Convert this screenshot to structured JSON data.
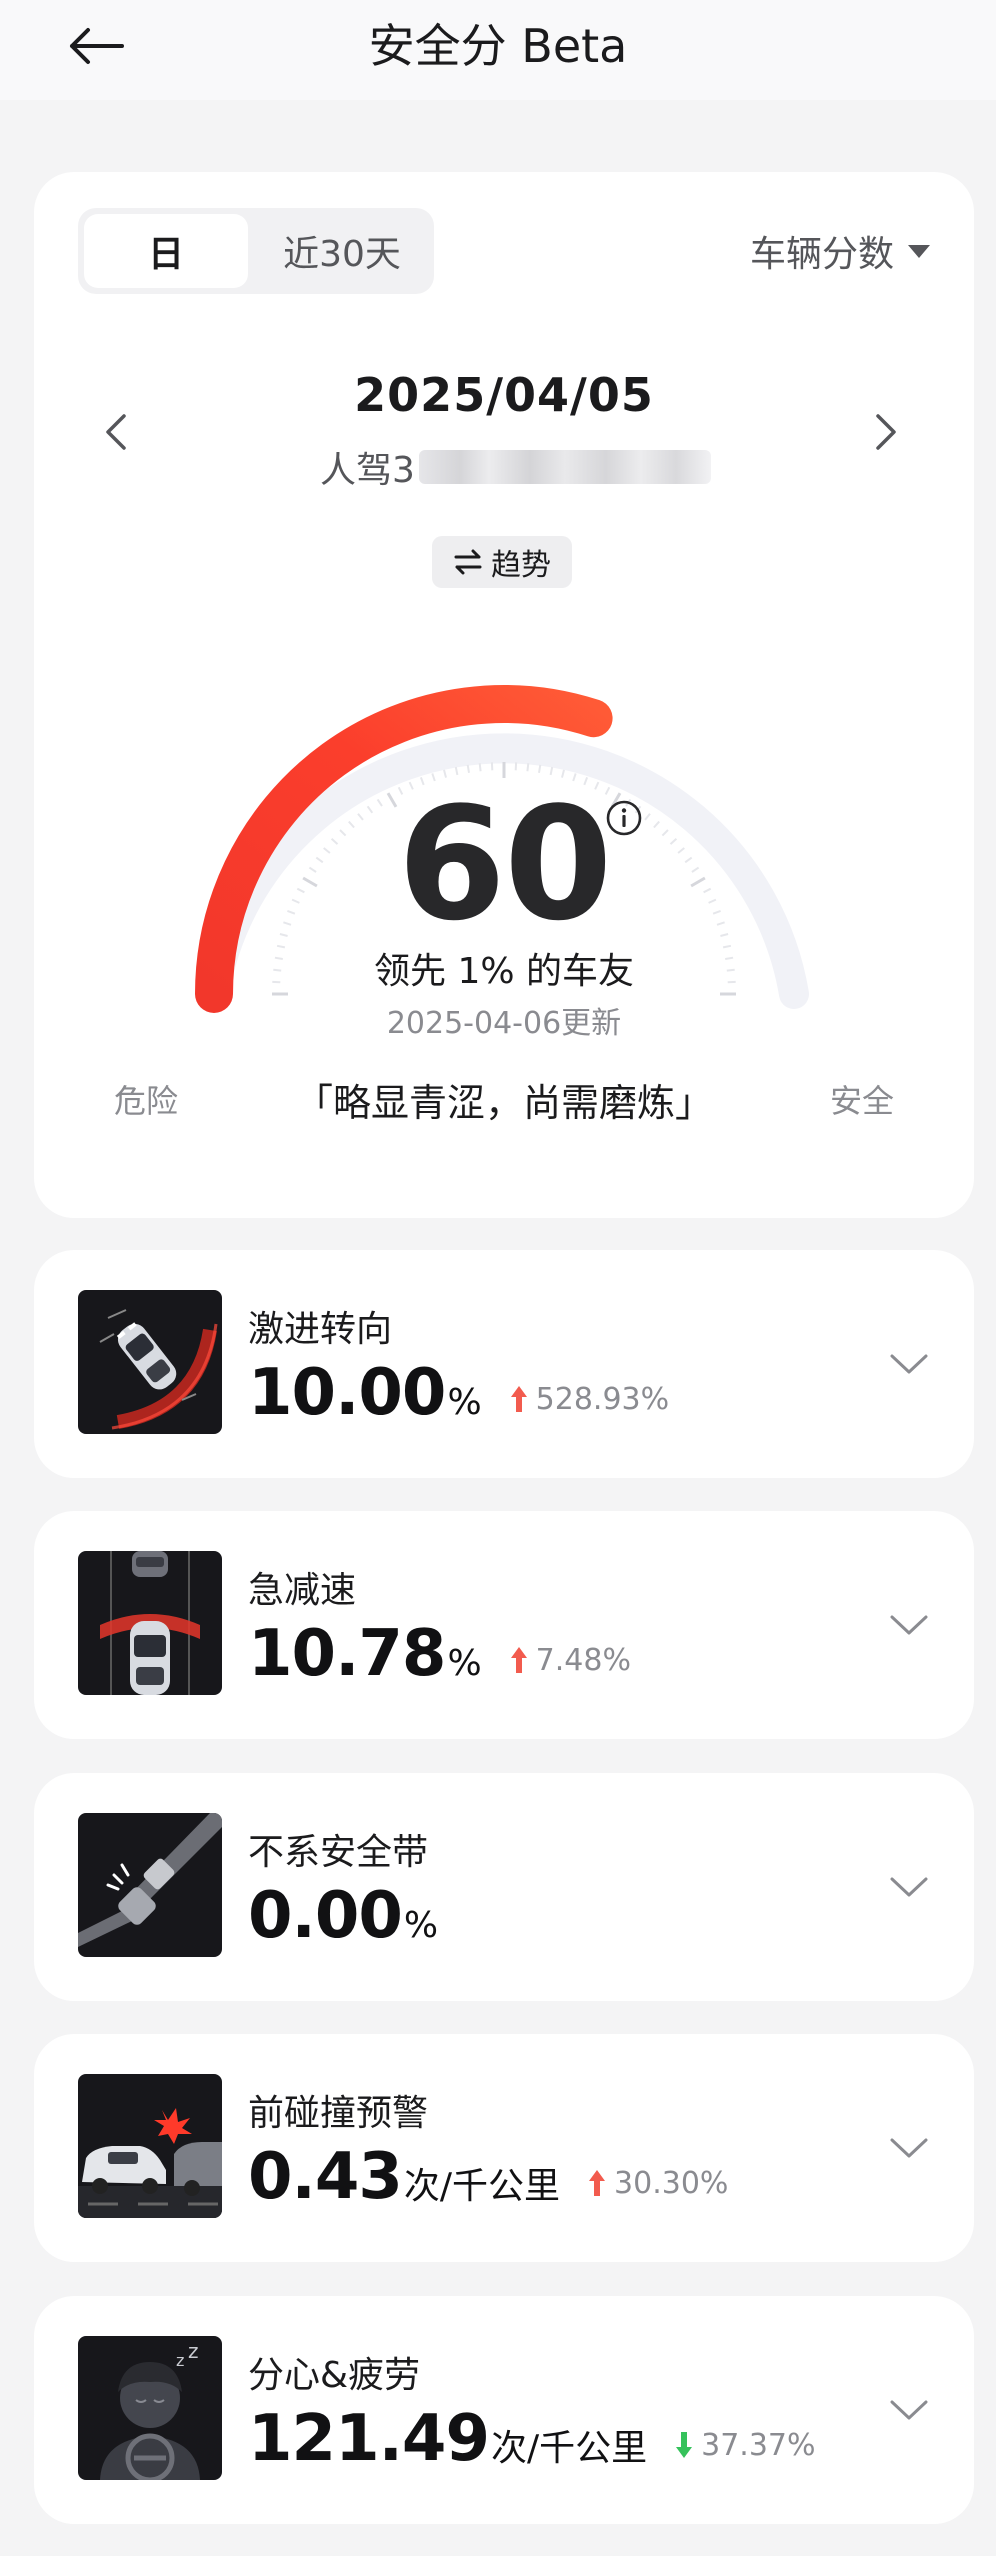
{
  "header": {
    "back_icon": "arrow-left-icon",
    "title": "安全分 Beta"
  },
  "score_card": {
    "tabs": [
      {
        "label": "日",
        "selected": true
      },
      {
        "label": "近30天",
        "selected": false
      }
    ],
    "vehicle_dropdown": "车辆分数",
    "date": "2025/04/05",
    "driver_label": "人驾3",
    "trend_button": "趋势",
    "score": "60",
    "score_fraction": 0.6,
    "lead_text": "领先 1% 的车友",
    "updated": "2025-04-06更新",
    "scale_low": "危险",
    "scale_high": "安全",
    "motto": "「略显青涩，尚需磨炼」",
    "colors": {
      "gauge_red": "#f6392a",
      "gauge_orange": "#ff5a36",
      "gauge_track": "#f1f2f7"
    }
  },
  "metrics": [
    {
      "title": "激进转向",
      "value": "10.00",
      "unit": "%",
      "change": "528.93%",
      "trend": "up",
      "icon": "aggressive-turn-icon"
    },
    {
      "title": "急减速",
      "value": "10.78",
      "unit": "%",
      "change": "7.48%",
      "trend": "up",
      "icon": "hard-braking-icon"
    },
    {
      "title": "不系安全带",
      "value": "0.00",
      "unit": "%",
      "change": "",
      "trend": "none",
      "icon": "seatbelt-icon"
    },
    {
      "title": "前碰撞预警",
      "value": "0.43",
      "unit": "次/千公里",
      "change": "30.30%",
      "trend": "up",
      "icon": "collision-warning-icon"
    },
    {
      "title": "分心&疲劳",
      "value": "121.49",
      "unit": "次/千公里",
      "change": "37.37%",
      "trend": "down",
      "icon": "distraction-fatigue-icon"
    }
  ],
  "trend_colors": {
    "up": "#f25b4e",
    "down": "#35c25b"
  }
}
